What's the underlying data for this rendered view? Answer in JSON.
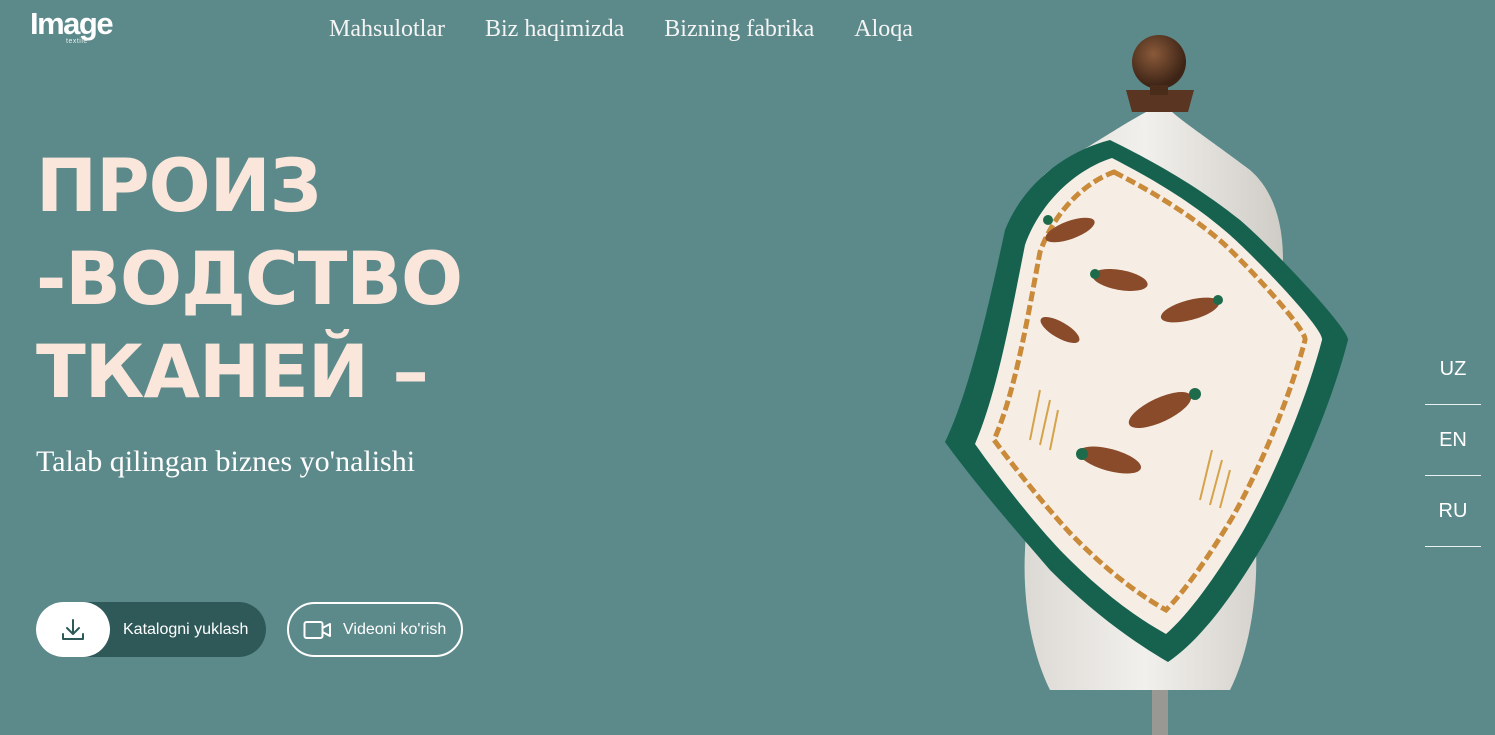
{
  "brand": {
    "name": "Image",
    "sub": "textile"
  },
  "nav": [
    "Mahsulotlar",
    "Biz haqimizda",
    "Bizning fabrika",
    "Aloqa"
  ],
  "headline": [
    "ПРОИЗ",
    "-ВОДСТВО",
    "ТКАНЕЙ –"
  ],
  "subtitle": "Talab qilingan biznes yo'nalishi",
  "buttons": {
    "catalog": {
      "label": "Katalogni yuklash",
      "icon": "download-icon"
    },
    "video": {
      "label": "Videoni ko'rish",
      "icon": "video-camera-icon"
    }
  },
  "languages": [
    "UZ",
    "EN",
    "RU"
  ],
  "colors": {
    "background": "#5c898a",
    "headline": "#fbe6dc",
    "button_dark": "#2f5859",
    "scarf_border": "#16624f"
  },
  "hero_image": {
    "subject": "mannequin-with-silk-scarf-illustration"
  }
}
